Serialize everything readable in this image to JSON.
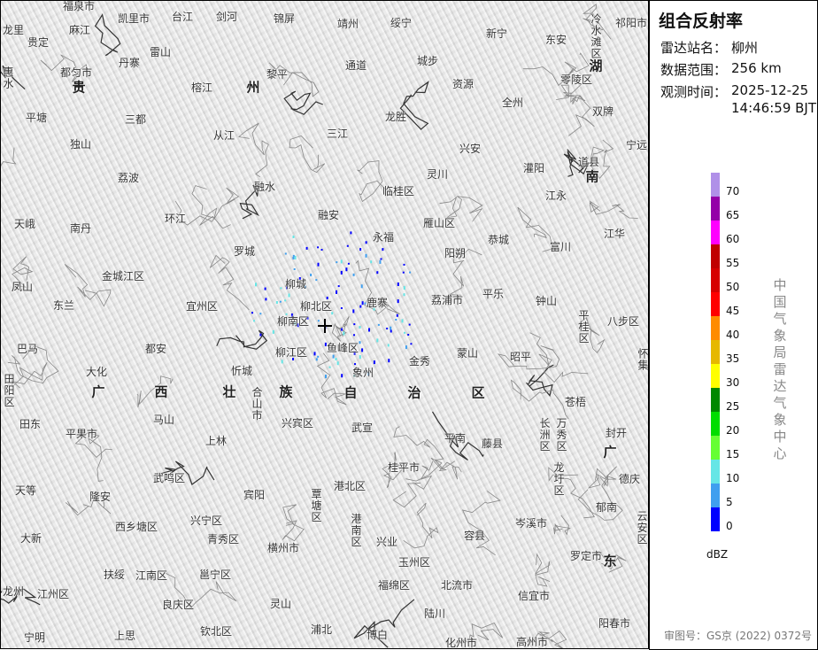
{
  "panel": {
    "title": "组合反射率",
    "station_label": "雷达站名：",
    "station": "柳州",
    "range_label": "数据范围：",
    "range": "256 km",
    "time_label": "观测时间：",
    "date": "2025-12-25",
    "time": "14:46:59 BJT",
    "credit": "中国气象局雷达气象中心",
    "footer": "审图号：GS京 (2022) 0372号"
  },
  "legend": {
    "unit": "dBZ",
    "ticks": [
      "70",
      "65",
      "60",
      "55",
      "50",
      "45",
      "40",
      "35",
      "30",
      "25",
      "20",
      "15",
      "10",
      "5",
      "0"
    ],
    "colors": [
      "#b090e8",
      "#9400a8",
      "#ff00ff",
      "#c00000",
      "#d60000",
      "#ff0000",
      "#ff8c00",
      "#e6b800",
      "#ffff00",
      "#008800",
      "#00dd00",
      "#66ff33",
      "#66e6e6",
      "#3f9fef",
      "#0000ff"
    ]
  },
  "map": {
    "radar_center_icon": "crosshair-icon",
    "labels": [
      "福泉市",
      "凯里市",
      "台江",
      "剑河",
      "锦屏",
      "靖州",
      "绥宁",
      "新宁",
      "东安",
      "冷水滩区",
      "祁阳市",
      "龙里",
      "麻江",
      "贵定",
      "雷山",
      "丹寨",
      "通道",
      "城步",
      "资源",
      "零陵区",
      "湖",
      "惠水",
      "都匀市",
      "贵",
      "黎平",
      "榕江",
      "州",
      "全州",
      "双牌",
      "平塘",
      "三都",
      "龙胜",
      "三江",
      "从江",
      "宁远",
      "兴安",
      "道县",
      "独山",
      "灌阳",
      "南",
      "灵川",
      "荔波",
      "融水",
      "临桂区",
      "江永",
      "融安",
      "天峨",
      "南丹",
      "环江",
      "雁山区",
      "江华",
      "永福",
      "恭城",
      "富川",
      "罗城",
      "阳朔",
      "金城江区",
      "凤山",
      "柳城",
      "鹿寨",
      "荔浦市",
      "平乐",
      "钟山",
      "平桂区",
      "八步区",
      "东兰",
      "宜州区",
      "柳北区",
      "柳南区",
      "巴马",
      "都安",
      "鱼峰区",
      "蒙山",
      "昭平",
      "怀集",
      "柳江区",
      "大化",
      "忻城",
      "金秀",
      "象州",
      "田阳区",
      "广",
      "西",
      "壮",
      "合山市",
      "族",
      "自",
      "治",
      "区",
      "苍梧",
      "田东",
      "马山",
      "兴宾区",
      "长洲区",
      "万秀区",
      "封开",
      "平果市",
      "武宣",
      "平南",
      "藤县",
      "上林",
      "广",
      "德庆",
      "桂平市",
      "武鸣区",
      "龙圩区",
      "港北区",
      "天等",
      "覃塘区",
      "隆安",
      "宾阳",
      "郁南",
      "港南区",
      "兴宁区",
      "岑溪市",
      "云安区",
      "西乡塘区",
      "兴业",
      "容县",
      "大新",
      "青秀区",
      "横州市",
      "罗定市",
      "东",
      "玉州区",
      "扶绥",
      "江南区",
      "邕宁区",
      "北流市",
      "福绵区",
      "龙州",
      "江州区",
      "良庆区",
      "灵山",
      "信宜市",
      "陆川",
      "阳春市",
      "宁明",
      "上思",
      "钦北区",
      "浦北",
      "博白",
      "化州市",
      "高州市"
    ]
  }
}
